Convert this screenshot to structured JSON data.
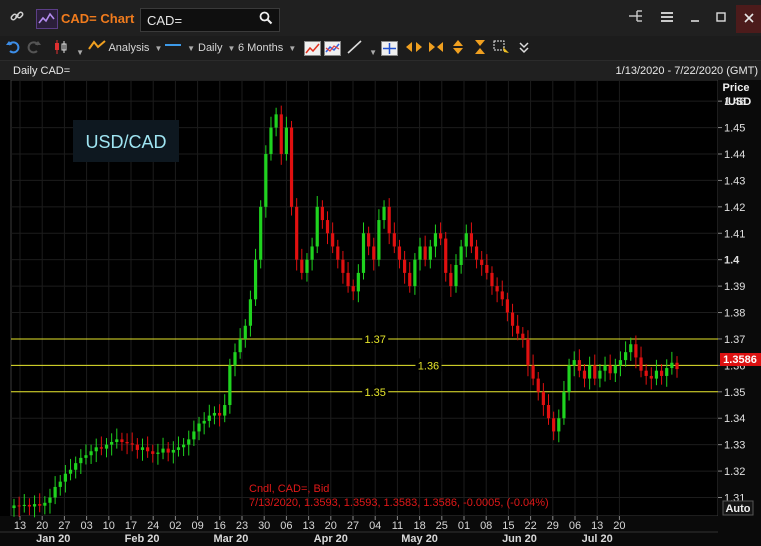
{
  "titlebar": {
    "app_title": "CAD= Chart",
    "search_value": "CAD=",
    "link_icon": "chain-link-icon",
    "app_icon": "chart-app-icon"
  },
  "toolbar": {
    "analysis_label": "Analysis",
    "interval_label": "Daily",
    "range_label": "6 Months"
  },
  "chart_header": {
    "left": "Daily CAD=",
    "right": "1/13/2020 - 7/22/2020 (GMT)"
  },
  "chart_data": {
    "type": "candlestick",
    "title": "USD/CAD",
    "ylabel": "Price /USD",
    "ylabel_line1": "Price",
    "ylabel_line2": "/USD",
    "ylim": [
      1.303,
      1.468
    ],
    "y_ticks": [
      1.31,
      1.32,
      1.33,
      1.34,
      1.35,
      1.36,
      1.37,
      1.38,
      1.39,
      1.4,
      1.41,
      1.42,
      1.43,
      1.44,
      1.45,
      1.46
    ],
    "x_ticks": [
      "13",
      "20",
      "27",
      "03",
      "10",
      "17",
      "24",
      "02",
      "09",
      "16",
      "23",
      "30",
      "06",
      "13",
      "20",
      "27",
      "04",
      "11",
      "18",
      "25",
      "01",
      "08",
      "15",
      "22",
      "29",
      "06",
      "13",
      "20"
    ],
    "month_labels": [
      {
        "label": "Jan 20",
        "center": 1.5
      },
      {
        "label": "Feb 20",
        "center": 5.5
      },
      {
        "label": "Mar 20",
        "center": 9.5
      },
      {
        "label": "Apr 20",
        "center": 14
      },
      {
        "label": "May 20",
        "center": 18
      },
      {
        "label": "Jun 20",
        "center": 22.5
      },
      {
        "label": "Jul 20",
        "center": 26
      }
    ],
    "horizontal_lines": [
      {
        "value": 1.37,
        "label": "1.37",
        "label_pos": 16
      },
      {
        "value": 1.36,
        "label": "1.36",
        "label_pos": 18.4
      },
      {
        "value": 1.35,
        "label": "1.35",
        "label_pos": 16
      }
    ],
    "last_price": "1.3586",
    "up_color": "#1fd31f",
    "down_color": "#e01010",
    "line_color": "#e5e52a",
    "auto_label": "Auto",
    "legend_line1": "Cndl, CAD=, Bid",
    "legend_line2": "7/13/2020, 1.3593, 1.3593, 1.3583, 1.3586, -0.0005, (-0.04%)",
    "closes": [
      1.307,
      1.3068,
      1.3072,
      1.3066,
      1.3075,
      1.3069,
      1.308,
      1.31,
      1.314,
      1.316,
      1.319,
      1.3205,
      1.323,
      1.325,
      1.326,
      1.3275,
      1.329,
      1.3285,
      1.33,
      1.331,
      1.332,
      1.331,
      1.3305,
      1.33,
      1.328,
      1.329,
      1.3275,
      1.3265,
      1.327,
      1.3285,
      1.327,
      1.328,
      1.329,
      1.33,
      1.332,
      1.335,
      1.338,
      1.339,
      1.341,
      1.342,
      1.341,
      1.345,
      1.36,
      1.365,
      1.37,
      1.375,
      1.385,
      1.4,
      1.42,
      1.44,
      1.45,
      1.455,
      1.44,
      1.45,
      1.42,
      1.4,
      1.395,
      1.4,
      1.405,
      1.42,
      1.415,
      1.41,
      1.405,
      1.4,
      1.395,
      1.39,
      1.388,
      1.395,
      1.41,
      1.405,
      1.4,
      1.415,
      1.42,
      1.41,
      1.405,
      1.4,
      1.395,
      1.39,
      1.4,
      1.405,
      1.4,
      1.405,
      1.41,
      1.408,
      1.395,
      1.39,
      1.398,
      1.405,
      1.41,
      1.405,
      1.4,
      1.398,
      1.395,
      1.39,
      1.388,
      1.385,
      1.38,
      1.375,
      1.372,
      1.37,
      1.36,
      1.355,
      1.35,
      1.345,
      1.34,
      1.335,
      1.34,
      1.35,
      1.36,
      1.362,
      1.358,
      1.355,
      1.36,
      1.355,
      1.358,
      1.36,
      1.357,
      1.36,
      1.362,
      1.365,
      1.368,
      1.363,
      1.358,
      1.356,
      1.355,
      1.358,
      1.356,
      1.359,
      1.361,
      1.3586
    ]
  }
}
